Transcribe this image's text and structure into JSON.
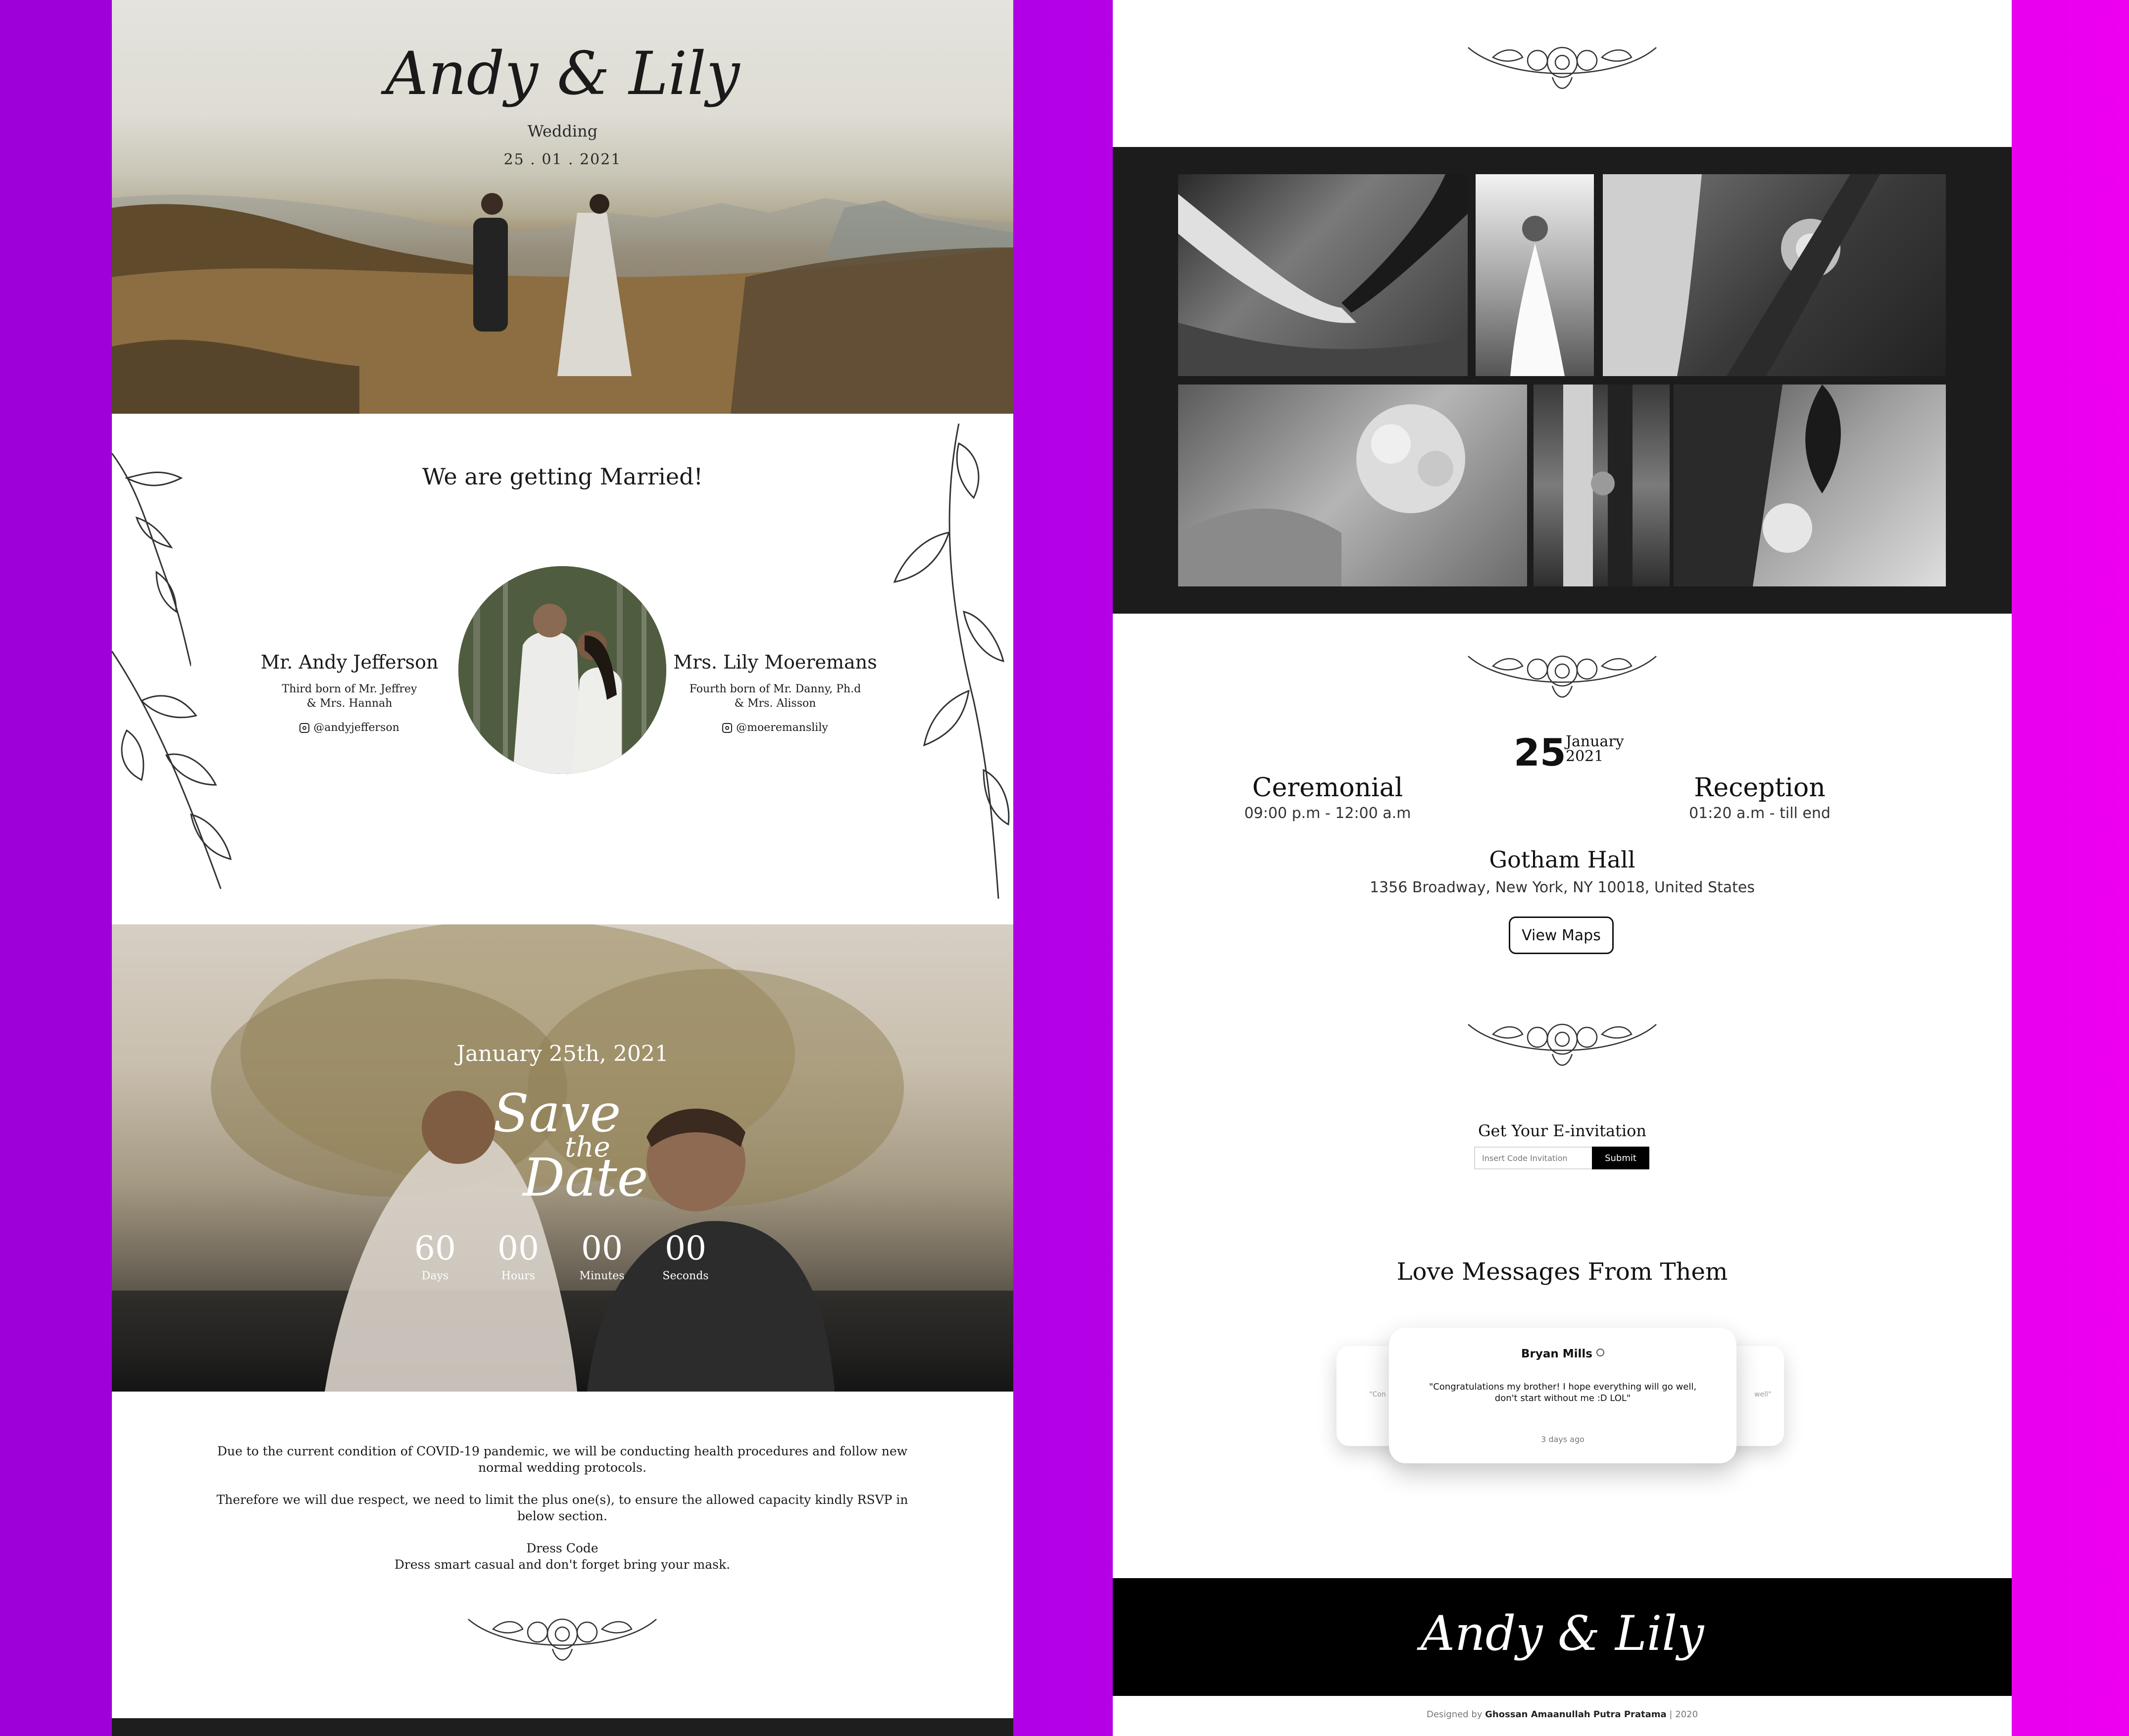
{
  "hero": {
    "names": "Andy & Lily",
    "subtitle": "Wedding",
    "date": "25 . 01 . 2021"
  },
  "intro": {
    "heading": "We are getting Married!"
  },
  "groom": {
    "name": "Mr. Andy Jefferson",
    "line1": "Third born of Mr. Jeffrey",
    "line2": "& Mrs. Hannah",
    "instagram": "@andyjefferson",
    "icon": "instagram-icon"
  },
  "bride": {
    "name": "Mrs. Lily Moeremans",
    "line1": "Fourth born of Mr. Danny, Ph.d",
    "line2": "& Mrs. Alisson",
    "instagram": "@moeremanslily",
    "icon": "instagram-icon"
  },
  "save_the_date": {
    "date": "January 25th, 2021",
    "script_1": "Save",
    "script_2": "the",
    "script_3": "Date",
    "countdown": [
      {
        "value": "60",
        "label": "Days"
      },
      {
        "value": "00",
        "label": "Hours"
      },
      {
        "value": "00",
        "label": "Minutes"
      },
      {
        "value": "00",
        "label": "Seconds"
      }
    ]
  },
  "notice": {
    "p1": "Due to the current condition of COVID-19 pandemic, we will be conducting health procedures and follow new normal wedding protocols.",
    "p2": "Therefore we will due respect, we need to limit the plus one(s), to ensure the allowed capacity kindly RSVP in below section.",
    "dress_title": "Dress Code",
    "dress_text": "Dress smart casual and don't forget bring your mask."
  },
  "schedule": {
    "day": "25",
    "month": "January",
    "year": "2021",
    "ceremonial": {
      "title": "Ceremonial",
      "time": "09:00 p.m - 12:00 a.m"
    },
    "reception": {
      "title": "Reception",
      "time": "01:20 a.m - till end"
    },
    "venue": "Gotham Hall",
    "address": "1356 Broadway, New York, NY 10018, United States",
    "maps_button": "View Maps"
  },
  "einvitation": {
    "label": "Get Your E-invitation",
    "placeholder": "Insert Code Invitation",
    "submit": "Submit"
  },
  "messages": {
    "heading": "Love Messages From Them",
    "left_peek": "\"Con",
    "right_peek": "well\"",
    "main": {
      "name": "Bryan Mills",
      "message": "\"Congratulations my brother! I hope everything will go well, don't start without me :D LOL\"",
      "time": "3 days ago"
    }
  },
  "footer": {
    "script": "Andy & Lily",
    "credit_prefix": "Designed by",
    "credit_name": "Ghossan Amaanullah Putra Pratama",
    "credit_suffix": " | 2020"
  },
  "colors": {
    "background_left": "#9d00d9",
    "background_right": "#ee00f0",
    "dark": "#1c1c1c",
    "black": "#000000"
  }
}
